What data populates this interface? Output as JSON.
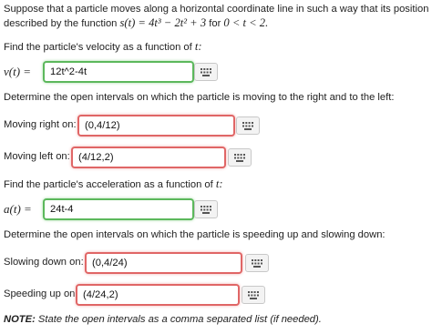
{
  "problem": {
    "line1": "Suppose that a particle moves along a horizontal coordinate line in such a way that its position is",
    "line2_prefix": "described by the function",
    "function": "s(t) = 4t³ − 2t² + 3",
    "domain_sep": "for",
    "domain": "0 < t < 2."
  },
  "velocity": {
    "prompt_prefix": "Find the particle's velocity as a function of",
    "prompt_var": "t:",
    "label": "v(t) =",
    "value": "12t^2-4t"
  },
  "direction": {
    "prompt": "Determine the open intervals on which the particle is moving to the right and to the left:",
    "right_label": "Moving right on:",
    "right_value": "(0,4/12)",
    "left_label": "Moving left on:",
    "left_value": "(4/12,2)"
  },
  "acceleration": {
    "prompt_prefix": "Find the particle's acceleration as a function of",
    "prompt_var": "t:",
    "label": "a(t) =",
    "value": "24t-4"
  },
  "speed": {
    "prompt": "Determine the open intervals on which the particle is speeding up and slowing down:",
    "slow_label": "Slowing down on:",
    "slow_value": "(0,4/24)",
    "fast_label": "Speeding up on:",
    "fast_value": "(4/24,2)"
  },
  "note": {
    "bold": "NOTE:",
    "text": "State the open intervals as a comma separated list (if needed)."
  },
  "colors": {
    "correct_border": "#5cb85c",
    "incorrect_border": "#e06666"
  },
  "icons": {
    "keyboard": "keypad-icon"
  }
}
